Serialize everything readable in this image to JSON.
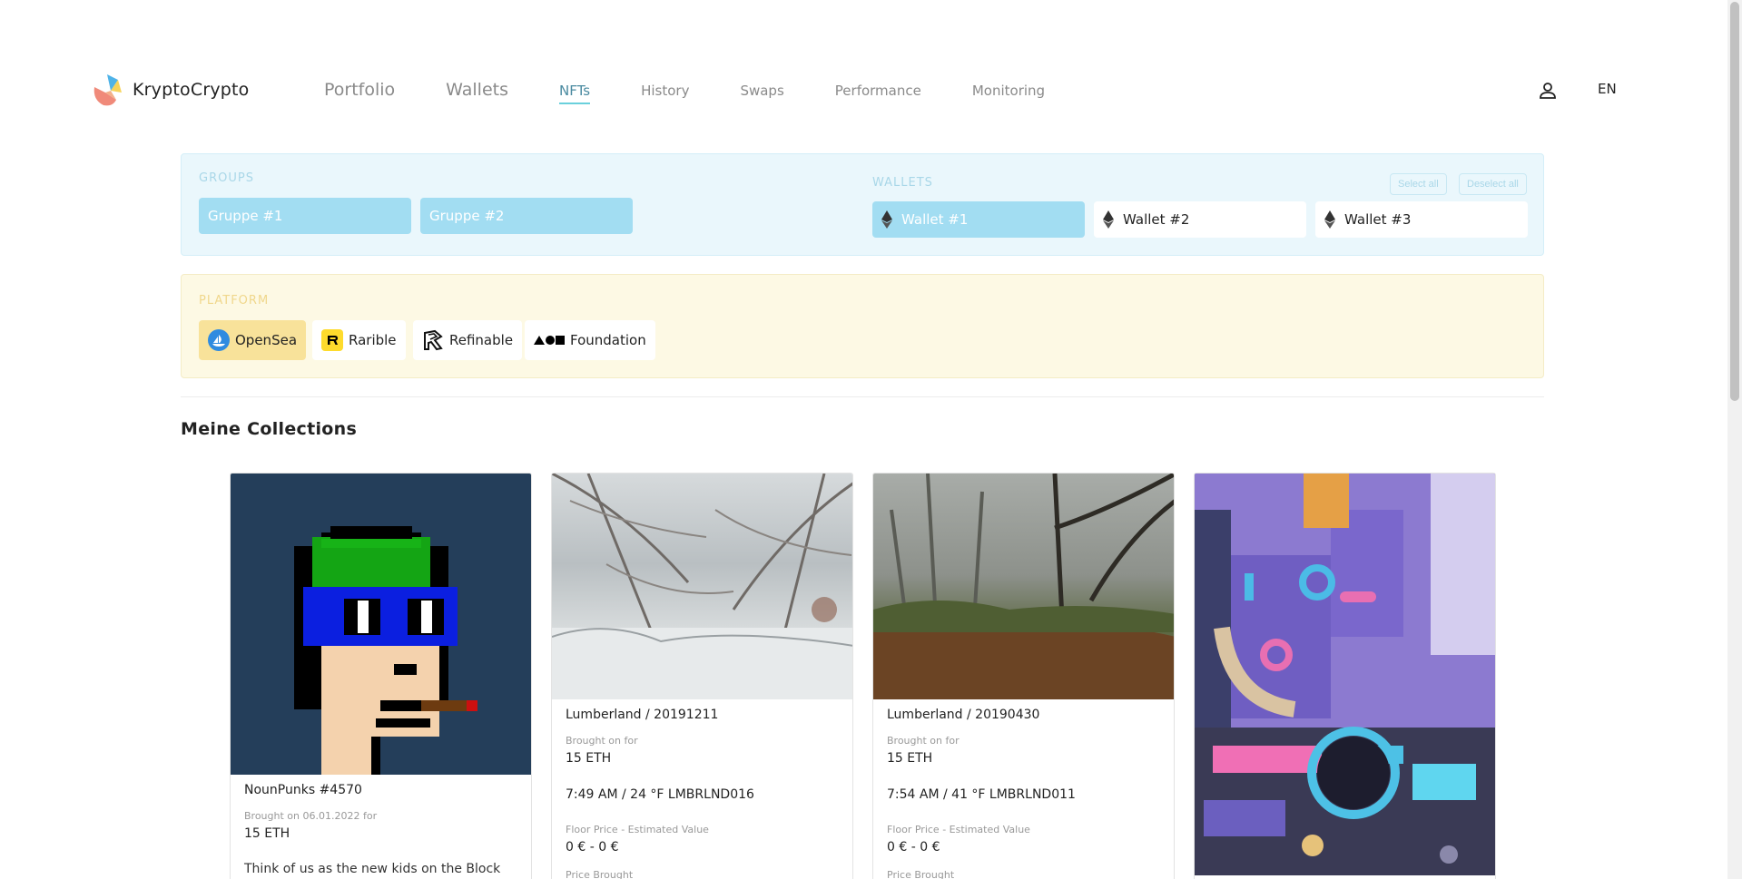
{
  "app": {
    "name": "KryptoCrypto"
  },
  "nav": {
    "items": [
      {
        "label": "Portfolio",
        "size": "big",
        "active": false
      },
      {
        "label": "Wallets",
        "size": "big",
        "active": false
      },
      {
        "label": "NFTs",
        "size": "small",
        "active": true
      },
      {
        "label": "History",
        "size": "small",
        "active": false
      },
      {
        "label": "Swaps",
        "size": "small",
        "active": false
      },
      {
        "label": "Performance",
        "size": "small",
        "active": false
      },
      {
        "label": "Monitoring",
        "size": "small",
        "active": false
      }
    ],
    "user_icon": "user-icon",
    "language": "EN"
  },
  "groups": {
    "label": "GROUPS",
    "items": [
      "Gruppe #1",
      "Gruppe #2"
    ]
  },
  "wallets": {
    "label": "WALLETS",
    "select_all": "Select all",
    "deselect_all": "Deselect all",
    "items": [
      {
        "label": "Wallet #1",
        "selected": true
      },
      {
        "label": "Wallet #2",
        "selected": false
      },
      {
        "label": "Wallet #3",
        "selected": false
      }
    ]
  },
  "platform": {
    "label": "PLATFORM",
    "items": [
      {
        "label": "OpenSea",
        "icon": "opensea-icon",
        "selected": true
      },
      {
        "label": "Rarible",
        "icon": "rarible-icon",
        "selected": false
      },
      {
        "label": "Refinable",
        "icon": "refinable-icon",
        "selected": false
      },
      {
        "label": "Foundation",
        "icon": "foundation-icon",
        "selected": false
      }
    ]
  },
  "collections": {
    "title": "Meine Collections",
    "cards": [
      {
        "name": "NounPunks #4570",
        "bought_label": "Brought on 06.01.2022 for",
        "bought_value": "15 ETH",
        "description": "Think of us as the new kids on the Block"
      },
      {
        "name": "Lumberland / 20191211",
        "bought_label": "Brought on for",
        "bought_value": "15 ETH",
        "meta": "7:49 AM / 24 °F LMBRLND016",
        "floor_label": "Floor Price - Estimated Value",
        "floor_value": "0 € - 0 €",
        "extra_label": "Price Brought"
      },
      {
        "name": "Lumberland / 20190430",
        "bought_label": "Brought on for",
        "bought_value": "15 ETH",
        "meta": "7:54 AM / 41 °F LMBRLND011",
        "floor_label": "Floor Price - Estimated Value",
        "floor_value": "0 € - 0 €",
        "extra_label": "Price Brought"
      },
      {
        "name": "",
        "bought_label": "",
        "bought_value": ""
      }
    ]
  },
  "colors": {
    "accent_blue": "#a2ddf2",
    "accent_yellow": "#f8e29a",
    "active_nav": "#4a8aa0"
  }
}
